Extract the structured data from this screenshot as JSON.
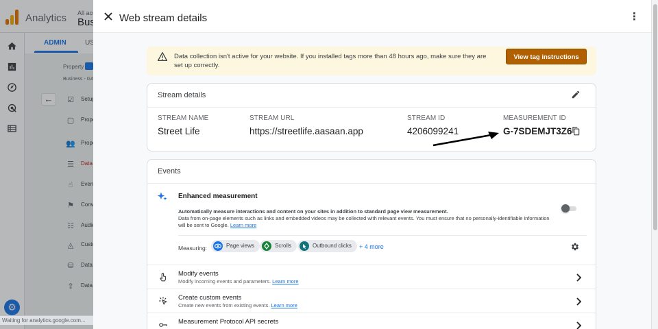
{
  "background": {
    "app_name": "Analytics",
    "account_small": "All acc",
    "account_big": "Bus",
    "tabs": {
      "admin": "ADMIN",
      "user": "US"
    },
    "property_label": "Property",
    "property_name": "Business - GA",
    "nav": [
      {
        "label": "Setup",
        "icon": "checklist-icon"
      },
      {
        "label": "Property",
        "icon": "property-icon"
      },
      {
        "label": "Property Management",
        "icon": "people-icon"
      },
      {
        "label": "Data Streams",
        "icon": "data-streams-icon"
      },
      {
        "label": "Events",
        "icon": "touch-icon"
      },
      {
        "label": "Conversions",
        "icon": "flag-icon"
      },
      {
        "label": "Audiences",
        "icon": "audience-icon"
      },
      {
        "label": "Custom",
        "icon": "custom-icon"
      },
      {
        "label": "Data",
        "icon": "database-icon"
      },
      {
        "label": "Data Import",
        "icon": "upload-icon"
      }
    ],
    "status_text": "Waiting for analytics.google.com..."
  },
  "panel": {
    "title": "Web stream details",
    "banner": {
      "text": "Data collection isn't active for your website. If you installed tags more than 48 hours ago, make sure they are set up correctly.",
      "button": "View tag instructions"
    },
    "stream_details": {
      "title": "Stream details",
      "columns": [
        {
          "label": "STREAM NAME",
          "value": "Street Life"
        },
        {
          "label": "STREAM URL",
          "value": "https://streetlife.aasaan.app"
        },
        {
          "label": "STREAM ID",
          "value": "4206099241"
        },
        {
          "label": "MEASUREMENT ID",
          "value": "G-7SDEMJT3Z6"
        }
      ]
    },
    "events": {
      "title": "Events",
      "enhanced": {
        "title": "Enhanced measurement",
        "desc_bold": "Automatically measure interactions and content on your sites in addition to standard page view measurement.",
        "desc": "Data from on-page elements such as links and embedded videos may be collected with relevant events. You must ensure that no personally-identifiable information will be sent to Google.",
        "learn_more": "Learn more",
        "measuring_label": "Measuring:",
        "chips": [
          {
            "label": "Page views",
            "color": "#1a73e8"
          },
          {
            "label": "Scrolls",
            "color": "#188038"
          },
          {
            "label": "Outbound clicks",
            "color": "#12737d"
          }
        ],
        "more": "+ 4 more"
      },
      "rows": [
        {
          "title": "Modify events",
          "sub": "Modify incoming events and parameters.",
          "learn": "Learn more"
        },
        {
          "title": "Create custom events",
          "sub": "Create new events from existing events.",
          "learn": "Learn more"
        },
        {
          "title": "Measurement Protocol API secrets",
          "sub": "",
          "learn": ""
        }
      ]
    }
  },
  "colors": {
    "accent": "#1a73e8",
    "warning_bg": "#fef7e0",
    "warning_button": "#b06000"
  }
}
